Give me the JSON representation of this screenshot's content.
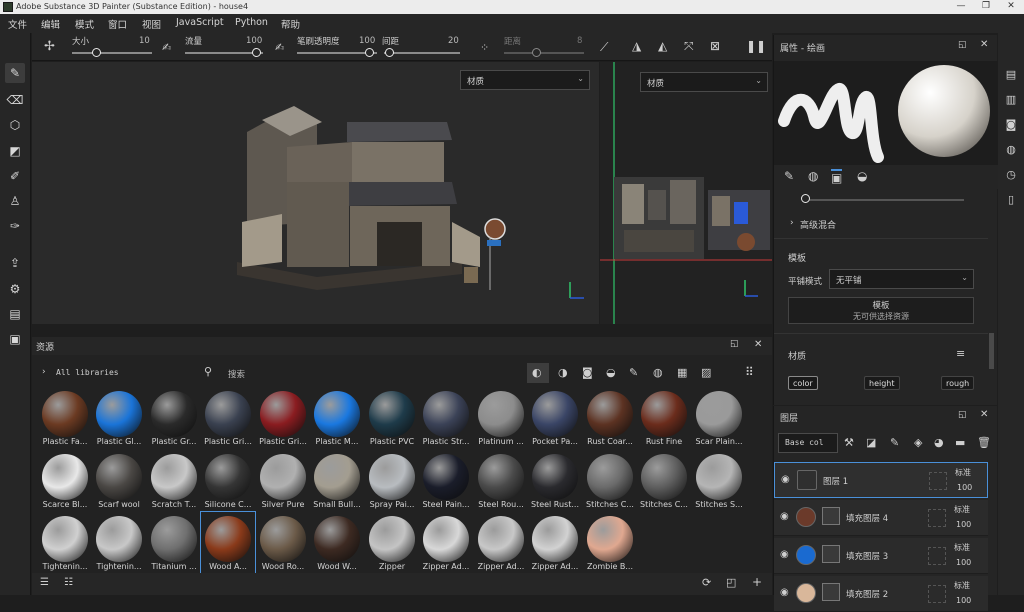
{
  "window": {
    "title": "Adobe Substance 3D Painter (Substance Edition) - house4",
    "controls": [
      "—",
      "❐",
      "✕"
    ]
  },
  "menu": [
    "文件",
    "编辑",
    "模式",
    "窗口",
    "视图",
    "JavaScript",
    "Python",
    "帮助"
  ],
  "toolbar": {
    "size_label": "大小",
    "size_value": "10",
    "flow_label": "流量",
    "flow_value": "100",
    "opacity_label": "笔刷透明度",
    "opacity_value": "100",
    "spacing_label": "间距",
    "spacing_value": "20",
    "distance_label": "距离",
    "distance_value": "8"
  },
  "viewport": {
    "view3d_dropdown": "材质",
    "view2d_dropdown": "材质"
  },
  "assets": {
    "title": "资源",
    "library": "All libraries",
    "search_placeholder": "搜索",
    "rows": [
      [
        {
          "name": "Plastic Fa...",
          "color": "#6b3a22"
        },
        {
          "name": "Plastic Gl...",
          "color": "#1a74d8"
        },
        {
          "name": "Plastic Gr...",
          "color": "#2a2a2a"
        },
        {
          "name": "Plastic Gri...",
          "color": "#3a4150"
        },
        {
          "name": "Plastic Gri...",
          "color": "#8a1c20"
        },
        {
          "name": "Plastic M...",
          "color": "#1a78e0"
        },
        {
          "name": "Plastic PVC",
          "color": "#1e3b4a"
        },
        {
          "name": "Plastic Str...",
          "color": "#3b4257"
        },
        {
          "name": "Platinum ...",
          "color": "#8c8c8c"
        },
        {
          "name": "Pocket Pa...",
          "color": "#3a4566"
        },
        {
          "name": "Rust Coar...",
          "color": "#5c3222"
        },
        {
          "name": "Rust Fine",
          "color": "#6b2c1c"
        },
        {
          "name": "Scar Plain...",
          "color": "#9a9a9a"
        }
      ],
      [
        {
          "name": "Scarce Bl...",
          "color": "#e8e8e8"
        },
        {
          "name": "Scarf wool",
          "color": "#4a4744"
        },
        {
          "name": "Scratch T...",
          "color": "#c8c8c8"
        },
        {
          "name": "Silicone C...",
          "color": "#353535"
        },
        {
          "name": "Silver Pure",
          "color": "#b0b0b0"
        },
        {
          "name": "Small Bull...",
          "color": "#a39d90"
        },
        {
          "name": "Spray Pai...",
          "color": "#b8bcc0"
        },
        {
          "name": "Steel Pain...",
          "color": "#1a1d2a"
        },
        {
          "name": "Steel Rou...",
          "color": "#4a4a4a"
        },
        {
          "name": "Steel Rust...",
          "color": "#2a2a2e"
        },
        {
          "name": "Stitches C...",
          "color": "#6a6a6a"
        },
        {
          "name": "Stitches C...",
          "color": "#5e5e5e"
        },
        {
          "name": "Stitches S...",
          "color": "#b5b5b5"
        }
      ],
      [
        {
          "name": "Tightenin...",
          "color": "#d0d0d0"
        },
        {
          "name": "Tightenin...",
          "color": "#c8c8c8"
        },
        {
          "name": "Titanium ...",
          "color": "#6f6f6f"
        },
        {
          "name": "Wood A...",
          "color": "#8a3a1a"
        },
        {
          "name": "Wood Ro...",
          "color": "#6b5a48"
        },
        {
          "name": "Wood W...",
          "color": "#3d2a22"
        },
        {
          "name": "Zipper",
          "color": "#c4c4c4"
        },
        {
          "name": "Zipper Ad...",
          "color": "#d8d8d8"
        },
        {
          "name": "Zipper Ad...",
          "color": "#c8c8c8"
        },
        {
          "name": "Zipper Ad...",
          "color": "#d2d2d2"
        },
        {
          "name": "Zombie B...",
          "color": "#e0a890"
        }
      ]
    ]
  },
  "props": {
    "title": "属性 - 绘画",
    "advanced_blend": "高级混合",
    "template_title": "模板",
    "tiling_label": "平铺模式",
    "tiling_value": "无平铺",
    "template_btn": "模板",
    "template_sub": "无可供选择资源",
    "material_title": "材质",
    "channels": [
      "color",
      "height",
      "rough"
    ]
  },
  "layers": {
    "title": "图层",
    "channel_select": "Base col",
    "items": [
      {
        "name": "图层 1",
        "blend": "标准",
        "opacity": "100",
        "thumb": "#2f2f2f"
      },
      {
        "name": "填充图层 4",
        "blend": "标准",
        "opacity": "100",
        "thumb": "#6b3a2a"
      },
      {
        "name": "填充图层 3",
        "blend": "标准",
        "opacity": "100",
        "thumb": "#1a6ad0"
      },
      {
        "name": "填充图层 2",
        "blend": "标准",
        "opacity": "100",
        "thumb": "#d9b79a"
      }
    ]
  }
}
